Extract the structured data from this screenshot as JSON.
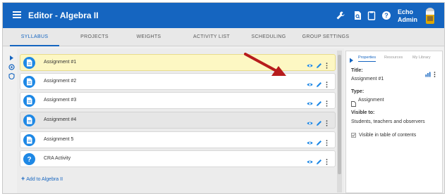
{
  "header": {
    "title": "Editor - Algebra II",
    "user_line1": "Echo",
    "user_line2": "Admin",
    "icons": [
      "wrench-icon",
      "document-search-icon",
      "clipboard-icon",
      "help-icon"
    ]
  },
  "tabs": [
    {
      "label": "SYLLABUS",
      "active": true
    },
    {
      "label": "PROJECTS",
      "active": false
    },
    {
      "label": "WEIGHTS",
      "active": false
    },
    {
      "label": "ACTIVITY LIST",
      "active": false
    },
    {
      "label": "SCHEDULING",
      "active": false
    },
    {
      "label": "GROUP SETTINGS",
      "active": false
    }
  ],
  "list": {
    "items": [
      {
        "label": "Assignment #1",
        "icon": "document-icon",
        "state": "highlighted"
      },
      {
        "label": "Assignment #2",
        "icon": "document-icon",
        "state": "normal"
      },
      {
        "label": "Assignment #3",
        "icon": "document-icon",
        "state": "normal"
      },
      {
        "label": "Assignment #4",
        "icon": "document-icon",
        "state": "hidden"
      },
      {
        "label": "Assignment 5",
        "icon": "document-icon",
        "state": "normal"
      },
      {
        "label": "CRA Activity",
        "icon": "question-icon",
        "state": "normal"
      }
    ],
    "add_label": "Add to Algebra II"
  },
  "properties": {
    "tabs": [
      "Properties",
      "Resources",
      "My Library"
    ],
    "title_label": "Title:",
    "title_value": "Assignment #1",
    "type_label": "Type:",
    "type_value": "Assignment",
    "visible_label": "Visible to:",
    "visible_value": "Students, teachers and observers",
    "toc_label": "Visible in table of contents"
  },
  "colors": {
    "brand": "#1565c0",
    "highlight_row": "#fdf7c3",
    "annotation_arrow": "#b71c1c"
  }
}
